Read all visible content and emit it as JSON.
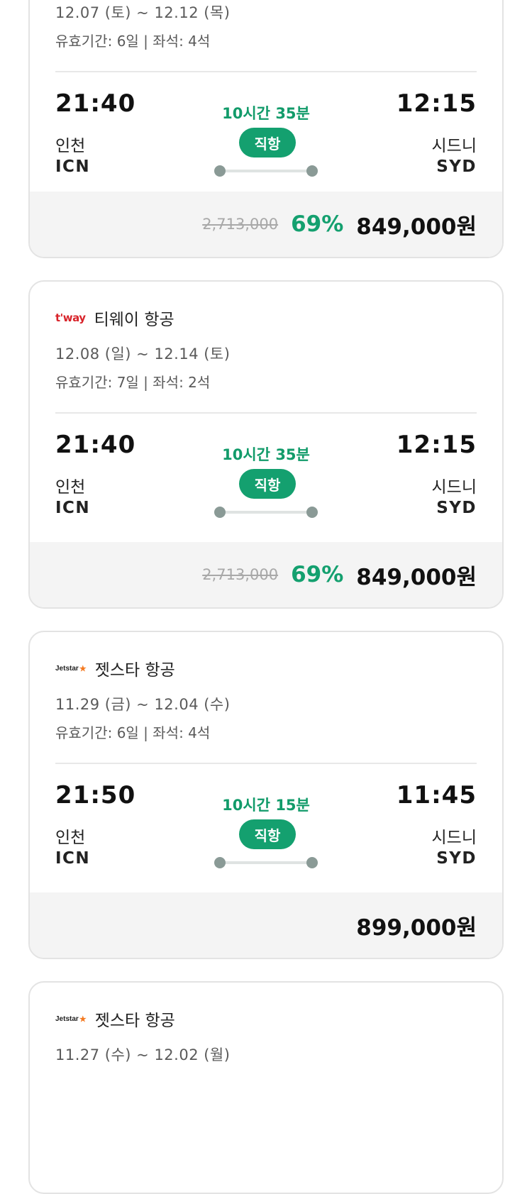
{
  "cards": [
    {
      "airline": "",
      "dates": "12.07 (토) ~ 12.12 (목)",
      "validity": "유효기간: 6일 | 좌석: 4석",
      "depart_time": "21:40",
      "depart_city": "인천",
      "depart_code": "ICN",
      "arrive_time": "12:15",
      "arrive_city": "시드니",
      "arrive_code": "SYD",
      "duration": "10시간 35분",
      "badge": "직항",
      "original_price": "2,713,000",
      "discount": "69%",
      "price": "849,000원"
    },
    {
      "airline": "티웨이 항공",
      "logo": "t'way",
      "dates": "12.08 (일) ~ 12.14 (토)",
      "validity": "유효기간: 7일 | 좌석: 2석",
      "depart_time": "21:40",
      "depart_city": "인천",
      "depart_code": "ICN",
      "arrive_time": "12:15",
      "arrive_city": "시드니",
      "arrive_code": "SYD",
      "duration": "10시간 35분",
      "badge": "직항",
      "original_price": "2,713,000",
      "discount": "69%",
      "price": "849,000원"
    },
    {
      "airline": "젯스타 항공",
      "logo": "Jetstar",
      "dates": "11.29 (금) ~ 12.04 (수)",
      "validity": "유효기간: 6일 | 좌석: 4석",
      "depart_time": "21:50",
      "depart_city": "인천",
      "depart_code": "ICN",
      "arrive_time": "11:45",
      "arrive_city": "시드니",
      "arrive_code": "SYD",
      "duration": "10시간 15분",
      "badge": "직항",
      "price": "899,000원"
    },
    {
      "airline": "젯스타 항공",
      "logo": "Jetstar",
      "dates": "11.27 (수) ~ 12.02 (월)"
    }
  ],
  "colors": {
    "accent": "#14a06f",
    "tway_red": "#d8232a",
    "jetstar_orange": "#f47920"
  }
}
